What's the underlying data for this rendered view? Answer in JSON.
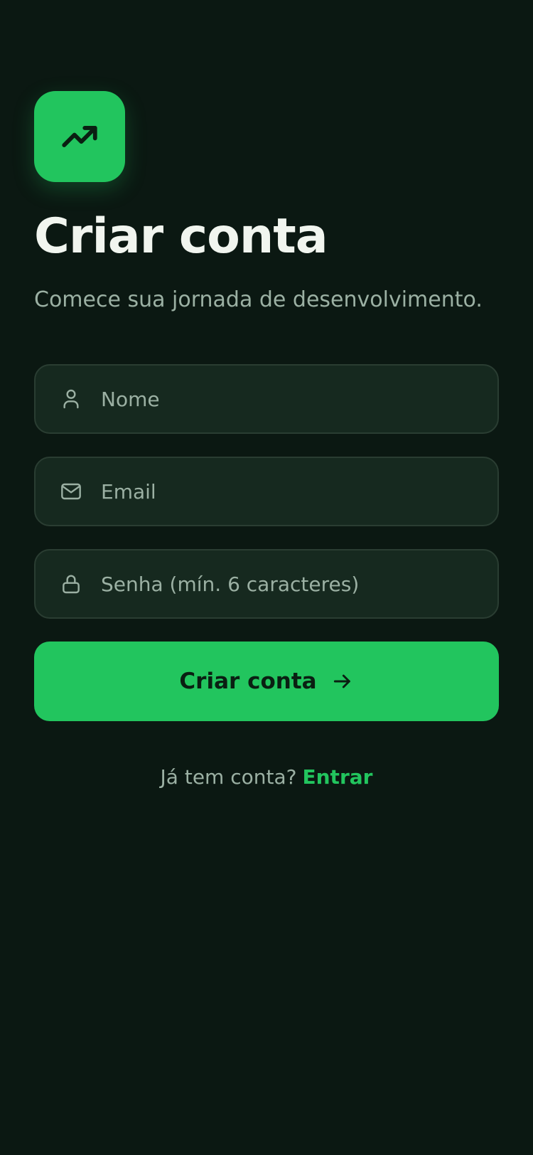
{
  "brand": {
    "icon": "trending-up-icon",
    "accent_color": "#22c55e"
  },
  "header": {
    "title": "Criar conta",
    "subtitle": "Comece sua jornada de desenvolvimento."
  },
  "form": {
    "name": {
      "placeholder": "Nome",
      "value": "",
      "icon": "user-icon"
    },
    "email": {
      "placeholder": "Email",
      "value": "",
      "icon": "mail-icon"
    },
    "password": {
      "placeholder": "Senha (mín. 6 caracteres)",
      "value": "",
      "icon": "lock-icon"
    },
    "submit_label": "Criar conta",
    "submit_icon": "arrow-right-icon"
  },
  "footer": {
    "prompt": "Já tem conta?",
    "link_label": "Entrar"
  },
  "colors": {
    "background": "#0b1812",
    "field_background": "#16291f",
    "text_primary": "#f1f5ef",
    "text_secondary": "#9bb0a3"
  }
}
